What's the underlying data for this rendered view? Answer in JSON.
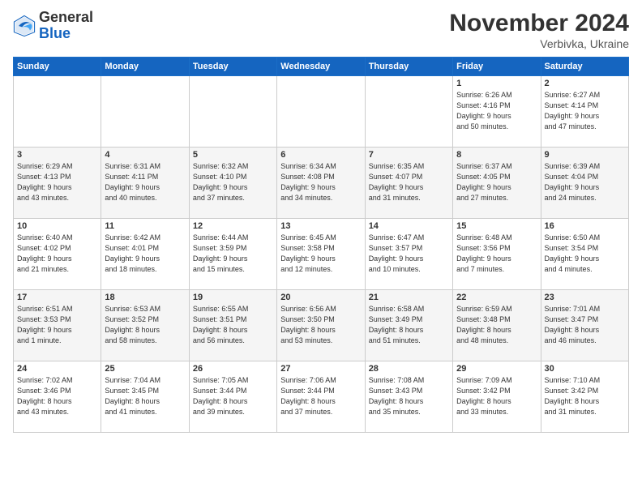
{
  "header": {
    "logo_general": "General",
    "logo_blue": "Blue",
    "month_title": "November 2024",
    "subtitle": "Verbivka, Ukraine"
  },
  "weekdays": [
    "Sunday",
    "Monday",
    "Tuesday",
    "Wednesday",
    "Thursday",
    "Friday",
    "Saturday"
  ],
  "weeks": [
    [
      {
        "day": "",
        "info": ""
      },
      {
        "day": "",
        "info": ""
      },
      {
        "day": "",
        "info": ""
      },
      {
        "day": "",
        "info": ""
      },
      {
        "day": "",
        "info": ""
      },
      {
        "day": "1",
        "info": "Sunrise: 6:26 AM\nSunset: 4:16 PM\nDaylight: 9 hours\nand 50 minutes."
      },
      {
        "day": "2",
        "info": "Sunrise: 6:27 AM\nSunset: 4:14 PM\nDaylight: 9 hours\nand 47 minutes."
      }
    ],
    [
      {
        "day": "3",
        "info": "Sunrise: 6:29 AM\nSunset: 4:13 PM\nDaylight: 9 hours\nand 43 minutes."
      },
      {
        "day": "4",
        "info": "Sunrise: 6:31 AM\nSunset: 4:11 PM\nDaylight: 9 hours\nand 40 minutes."
      },
      {
        "day": "5",
        "info": "Sunrise: 6:32 AM\nSunset: 4:10 PM\nDaylight: 9 hours\nand 37 minutes."
      },
      {
        "day": "6",
        "info": "Sunrise: 6:34 AM\nSunset: 4:08 PM\nDaylight: 9 hours\nand 34 minutes."
      },
      {
        "day": "7",
        "info": "Sunrise: 6:35 AM\nSunset: 4:07 PM\nDaylight: 9 hours\nand 31 minutes."
      },
      {
        "day": "8",
        "info": "Sunrise: 6:37 AM\nSunset: 4:05 PM\nDaylight: 9 hours\nand 27 minutes."
      },
      {
        "day": "9",
        "info": "Sunrise: 6:39 AM\nSunset: 4:04 PM\nDaylight: 9 hours\nand 24 minutes."
      }
    ],
    [
      {
        "day": "10",
        "info": "Sunrise: 6:40 AM\nSunset: 4:02 PM\nDaylight: 9 hours\nand 21 minutes."
      },
      {
        "day": "11",
        "info": "Sunrise: 6:42 AM\nSunset: 4:01 PM\nDaylight: 9 hours\nand 18 minutes."
      },
      {
        "day": "12",
        "info": "Sunrise: 6:44 AM\nSunset: 3:59 PM\nDaylight: 9 hours\nand 15 minutes."
      },
      {
        "day": "13",
        "info": "Sunrise: 6:45 AM\nSunset: 3:58 PM\nDaylight: 9 hours\nand 12 minutes."
      },
      {
        "day": "14",
        "info": "Sunrise: 6:47 AM\nSunset: 3:57 PM\nDaylight: 9 hours\nand 10 minutes."
      },
      {
        "day": "15",
        "info": "Sunrise: 6:48 AM\nSunset: 3:56 PM\nDaylight: 9 hours\nand 7 minutes."
      },
      {
        "day": "16",
        "info": "Sunrise: 6:50 AM\nSunset: 3:54 PM\nDaylight: 9 hours\nand 4 minutes."
      }
    ],
    [
      {
        "day": "17",
        "info": "Sunrise: 6:51 AM\nSunset: 3:53 PM\nDaylight: 9 hours\nand 1 minute."
      },
      {
        "day": "18",
        "info": "Sunrise: 6:53 AM\nSunset: 3:52 PM\nDaylight: 8 hours\nand 58 minutes."
      },
      {
        "day": "19",
        "info": "Sunrise: 6:55 AM\nSunset: 3:51 PM\nDaylight: 8 hours\nand 56 minutes."
      },
      {
        "day": "20",
        "info": "Sunrise: 6:56 AM\nSunset: 3:50 PM\nDaylight: 8 hours\nand 53 minutes."
      },
      {
        "day": "21",
        "info": "Sunrise: 6:58 AM\nSunset: 3:49 PM\nDaylight: 8 hours\nand 51 minutes."
      },
      {
        "day": "22",
        "info": "Sunrise: 6:59 AM\nSunset: 3:48 PM\nDaylight: 8 hours\nand 48 minutes."
      },
      {
        "day": "23",
        "info": "Sunrise: 7:01 AM\nSunset: 3:47 PM\nDaylight: 8 hours\nand 46 minutes."
      }
    ],
    [
      {
        "day": "24",
        "info": "Sunrise: 7:02 AM\nSunset: 3:46 PM\nDaylight: 8 hours\nand 43 minutes."
      },
      {
        "day": "25",
        "info": "Sunrise: 7:04 AM\nSunset: 3:45 PM\nDaylight: 8 hours\nand 41 minutes."
      },
      {
        "day": "26",
        "info": "Sunrise: 7:05 AM\nSunset: 3:44 PM\nDaylight: 8 hours\nand 39 minutes."
      },
      {
        "day": "27",
        "info": "Sunrise: 7:06 AM\nSunset: 3:44 PM\nDaylight: 8 hours\nand 37 minutes."
      },
      {
        "day": "28",
        "info": "Sunrise: 7:08 AM\nSunset: 3:43 PM\nDaylight: 8 hours\nand 35 minutes."
      },
      {
        "day": "29",
        "info": "Sunrise: 7:09 AM\nSunset: 3:42 PM\nDaylight: 8 hours\nand 33 minutes."
      },
      {
        "day": "30",
        "info": "Sunrise: 7:10 AM\nSunset: 3:42 PM\nDaylight: 8 hours\nand 31 minutes."
      }
    ]
  ]
}
